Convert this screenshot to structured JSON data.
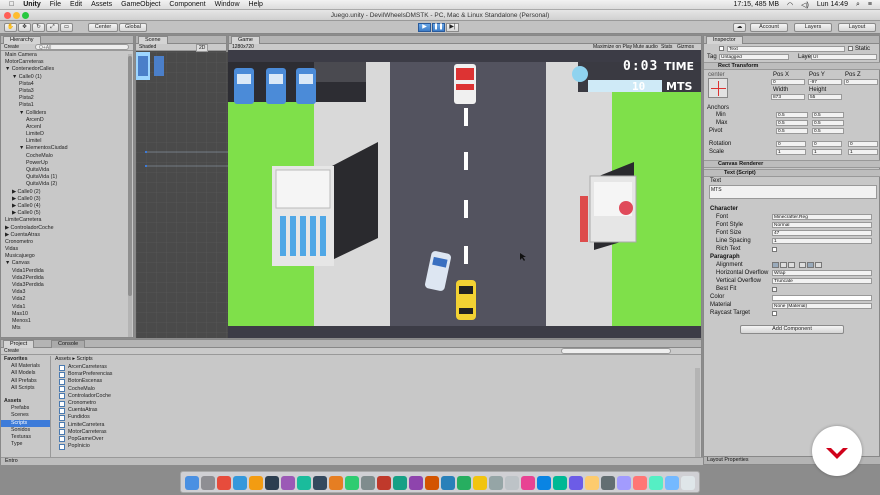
{
  "menubar": {
    "app": "Unity",
    "items": [
      "File",
      "Edit",
      "Assets",
      "GameObject",
      "Component",
      "Window",
      "Help"
    ],
    "status": "17:15, 485 MB",
    "clock": "Lun 14:49"
  },
  "window_title": "Juego.unity - DevilWheelsDMSTK - PC, Mac & Linux Standalone (Personal)",
  "toolbar": {
    "center": "Center",
    "global": "Global",
    "account": "Account",
    "layers": "Layers",
    "layout": "Layout"
  },
  "hierarchy": {
    "tab": "Hierarchy",
    "create": "Create",
    "search": "Q+All",
    "items": [
      {
        "label": "Main Camera",
        "indent": 0
      },
      {
        "label": "MotorCarreteras",
        "indent": 0
      },
      {
        "label": "▼ ContenedorCalles",
        "indent": 0
      },
      {
        "label": "▼ Calle0 (1)",
        "indent": 1
      },
      {
        "label": "Pista4",
        "indent": 2
      },
      {
        "label": "Pista3",
        "indent": 2
      },
      {
        "label": "Pista2",
        "indent": 2
      },
      {
        "label": "Pista1",
        "indent": 2
      },
      {
        "label": "▼ Colliders",
        "indent": 2
      },
      {
        "label": "ArcenD",
        "indent": 3
      },
      {
        "label": "ArcenI",
        "indent": 3
      },
      {
        "label": "LimiteD",
        "indent": 3
      },
      {
        "label": "LimiteI",
        "indent": 3
      },
      {
        "label": "▼ ElementosCiudad",
        "indent": 2
      },
      {
        "label": "CocheMalo",
        "indent": 3
      },
      {
        "label": "PowerUp",
        "indent": 3
      },
      {
        "label": "QuitaVida",
        "indent": 3
      },
      {
        "label": "QuitaVida (1)",
        "indent": 3
      },
      {
        "label": "QuitaVida (2)",
        "indent": 3
      },
      {
        "label": "▶ Calle0 (2)",
        "indent": 1
      },
      {
        "label": "▶ Calle0 (3)",
        "indent": 1
      },
      {
        "label": "▶ Calle0 (4)",
        "indent": 1
      },
      {
        "label": "▶ Calle0 (5)",
        "indent": 1
      },
      {
        "label": "LimiteCarretera",
        "indent": 0
      },
      {
        "label": "▶ ControladorCoche",
        "indent": 0
      },
      {
        "label": "▶ CuentaAtras",
        "indent": 0
      },
      {
        "label": "Cronometro",
        "indent": 0
      },
      {
        "label": "Vidas",
        "indent": 0
      },
      {
        "label": "Musicajuego",
        "indent": 0
      },
      {
        "label": "▼ Canvas",
        "indent": 0
      },
      {
        "label": "Vida1Perdida",
        "indent": 1
      },
      {
        "label": "Vida2Perdida",
        "indent": 1
      },
      {
        "label": "Vida3Perdida",
        "indent": 1
      },
      {
        "label": "Vida3",
        "indent": 1
      },
      {
        "label": "Vida2",
        "indent": 1
      },
      {
        "label": "Vida1",
        "indent": 1
      },
      {
        "label": "Mas10",
        "indent": 1
      },
      {
        "label": "Menos1",
        "indent": 1
      },
      {
        "label": "Mts",
        "indent": 1
      }
    ]
  },
  "scene": {
    "tab": "Scene",
    "shaded": "Shaded",
    "mode": "2D"
  },
  "game": {
    "tab": "Game",
    "resolution": "1280x720",
    "options": [
      "Maximize on Play",
      "Mute audio",
      "Stats",
      "Gizmos"
    ],
    "hud_time": "0:03",
    "hud_time_label": "TIME",
    "hud_mts": "10",
    "hud_mts_label": "MTS"
  },
  "project": {
    "tabs": [
      "Project",
      "Console"
    ],
    "create": "Create",
    "favorites_label": "Favorites",
    "favorites": [
      "All Materials",
      "All Models",
      "All Prefabs",
      "All Scripts"
    ],
    "assets_label": "Assets",
    "folders": [
      "Prefabs",
      "Scenes",
      "Scripts",
      "Sonidos",
      "Texturas",
      "Type"
    ],
    "breadcrumb": "Assets ▸ Scripts",
    "scripts": [
      "ArcenCarreteras",
      "BorrarPreferencias",
      "BotonEscenas",
      "CocheMalo",
      "ControladorCoche",
      "Cronometro",
      "CuentaAtras",
      "Fundidos",
      "LimiteCarretera",
      "MotorCarreteras",
      "PopGameOver",
      "PopInicio"
    ],
    "footer": "Entro"
  },
  "inspector": {
    "tab": "Inspector",
    "object_name": "Text",
    "static_label": "Static",
    "tag_label": "Tag",
    "tag_value": "Untagged",
    "layer_label": "Layer",
    "layer_value": "UI",
    "rect_transform": "Rect Transform",
    "anchor_preset": "center",
    "pos_x_label": "Pos X",
    "pos_y_label": "Pos Y",
    "pos_z_label": "Pos Z",
    "pos_x": "0",
    "pos_y": "-97",
    "pos_z": "0",
    "width_label": "Width",
    "height_label": "Height",
    "width": "873",
    "height": "55",
    "anchors_label": "Anchors",
    "min_label": "Min",
    "max_label": "Max",
    "pivot_label": "Pivot",
    "anchor_min_x": "0.5",
    "anchor_min_y": "0.5",
    "anchor_max_x": "0.5",
    "anchor_max_y": "0.5",
    "pivot_x": "0.5",
    "pivot_y": "0.5",
    "rotation_label": "Rotation",
    "scale_label": "Scale",
    "rot_x": "0",
    "rot_y": "0",
    "rot_z": "0",
    "scale_x": "1",
    "scale_y": "1",
    "scale_z": "1",
    "canvas_renderer": "Canvas Renderer",
    "text_script": "Text (Script)",
    "text_label": "Text",
    "text_value": "MTS",
    "character_label": "Character",
    "font_label": "Font",
    "font_value": "Minecrafter.Reg",
    "font_style_label": "Font Style",
    "font_style_value": "Normal",
    "font_size_label": "Font Size",
    "font_size_value": "47",
    "line_spacing_label": "Line Spacing",
    "line_spacing_value": "1",
    "rich_text_label": "Rich Text",
    "paragraph_label": "Paragraph",
    "alignment_label": "Alignment",
    "h_overflow_label": "Horizontal Overflow",
    "h_overflow_value": "Wrap",
    "v_overflow_label": "Vertical Overflow",
    "v_overflow_value": "Truncate",
    "best_fit_label": "Best Fit",
    "color_label": "Color",
    "material_label": "Material",
    "material_value": "None (Material)",
    "raycast_label": "Raycast Target",
    "add_component": "Add Component",
    "layout_props": "Layout Properties"
  },
  "colors": {
    "grass": "#7fe04a",
    "road": "#53535f",
    "sidewalk": "#d9d9d9",
    "selection": "#3d7bd9",
    "brand": "#d0021b"
  }
}
